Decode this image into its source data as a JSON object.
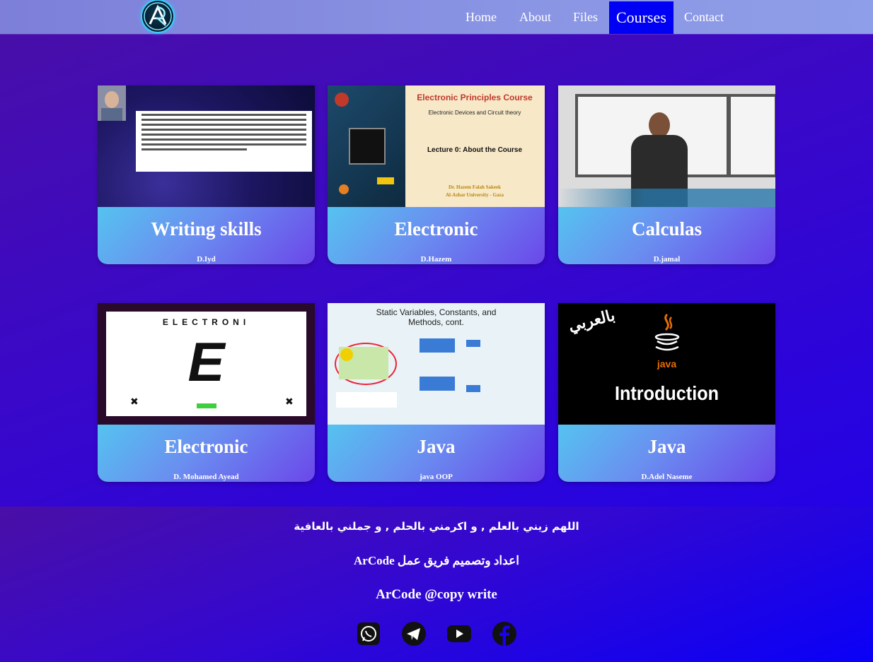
{
  "nav": {
    "links": [
      "Home",
      "About",
      "Files",
      "Courses",
      "Contact"
    ],
    "active": "Courses"
  },
  "courses": [
    {
      "title": "Writing skills",
      "author": "D.Iyd",
      "thumb": "writing-skills-slide"
    },
    {
      "title": "Electronic",
      "author": "D.Hazem",
      "thumb": "electronic-principles-slide",
      "thumb_text": {
        "heading": "Electronic Principles Course",
        "sub": "Electronic Devices and Circuit theory",
        "lecture": "Lecture 0: About the Course",
        "presenter": "Dr. Hazem Falah Sakeek",
        "university": "Al-Azhar University - Gaza"
      }
    },
    {
      "title": "Calculas",
      "author": "D.jamal",
      "thumb": "lecturer-whiteboard-photo"
    },
    {
      "title": "Electronic",
      "author": "D. Mohamed Ayead",
      "thumb": "electronic-device-intro",
      "thumb_text": {
        "heading": "ELECTRONI",
        "letter": "E"
      }
    },
    {
      "title": "Java",
      "author": "java OOP",
      "thumb": "static-variables-slide",
      "thumb_text": {
        "heading": "Static Variables, Constants, and Methods, cont."
      }
    },
    {
      "title": "Java",
      "author": "D.Adel Naseme",
      "thumb": "java-introduction-slide",
      "thumb_text": {
        "arabic": "بالعربي",
        "logo": "java",
        "heading": "Introduction"
      }
    }
  ],
  "footer": {
    "prayer": "اللهم زيني بالعلم , و اكرمني بالحلم , و جملني بالعافية",
    "credit": "اعداد وتصميم فريق عمل ArCode",
    "copyright": "ArCode @copy write",
    "socials": [
      "whatsapp-icon",
      "telegram-icon",
      "youtube-icon",
      "facebook-icon"
    ]
  },
  "colors": {
    "nav_active_bg": "#0000f5",
    "card_gradient_start": "#55c3f0",
    "card_gradient_end": "#6b47ea"
  }
}
